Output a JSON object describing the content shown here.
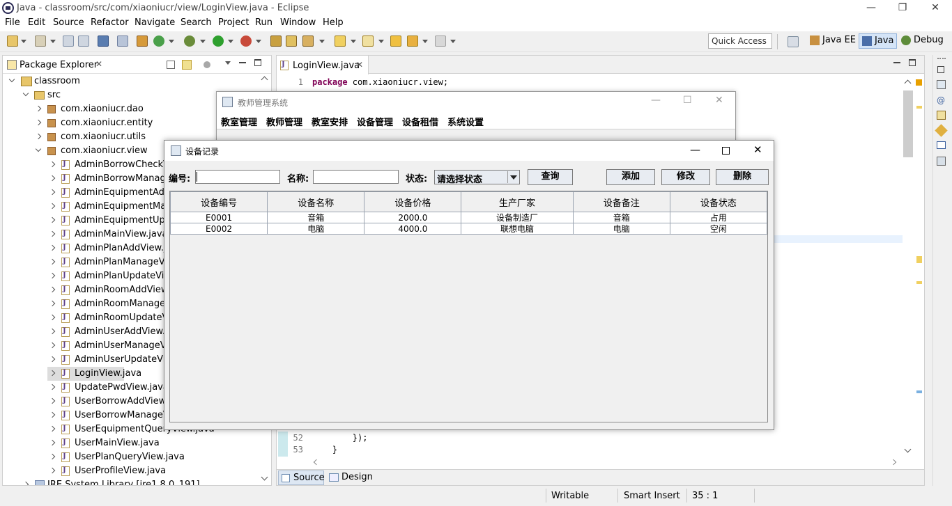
{
  "window": {
    "title": "Java - classroom/src/com/xiaoniucr/view/LoginView.java - Eclipse"
  },
  "menu": [
    "File",
    "Edit",
    "Source",
    "Refactor",
    "Navigate",
    "Search",
    "Project",
    "Run",
    "Window",
    "Help"
  ],
  "quick_access": "Quick Access",
  "perspectives": {
    "java_ee": "Java EE",
    "java": "Java",
    "debug": "Debug"
  },
  "package_explorer": {
    "tab_label": "Package Explorer",
    "project": "classroom",
    "src": "src",
    "packages": [
      "com.xiaoniucr.dao",
      "com.xiaoniucr.entity",
      "com.xiaoniucr.utils",
      "com.xiaoniucr.view"
    ],
    "files": [
      "AdminBorrowCheckView.java",
      "AdminBorrowManageView.java",
      "AdminEquipmentAddView.java",
      "AdminEquipmentManageView.java",
      "AdminEquipmentUpdateView.java",
      "AdminMainView.java",
      "AdminPlanAddView.java",
      "AdminPlanManageView.java",
      "AdminPlanUpdateView.java",
      "AdminRoomAddView.java",
      "AdminRoomManageView.java",
      "AdminRoomUpdateView.java",
      "AdminUserAddView.java",
      "AdminUserManageView.java",
      "AdminUserUpdateView.java",
      "LoginView.java",
      "UpdatePwdView.java",
      "UserBorrowAddView.java",
      "UserBorrowManageView.java",
      "UserEquipmentQueryView.java",
      "UserMainView.java",
      "UserPlanQueryView.java",
      "UserProfileView.java"
    ],
    "jre": "JRE System Library [jre1.8.0_191]"
  },
  "editor": {
    "tab_label": "LoginView.java",
    "line1": {
      "num": "1",
      "keyword": "package",
      "text": " com.xiaoniucr.view;"
    },
    "line52": {
      "num": "52",
      "text": "        });"
    },
    "line53": {
      "num": "53",
      "text": "    }"
    },
    "bottom_tabs": {
      "source": "Source",
      "design": "Design"
    }
  },
  "status_bar": {
    "writable": "Writable",
    "insert_mode": "Smart Insert",
    "position": "35 : 1"
  },
  "main_app": {
    "title": "教师管理系统",
    "menu": [
      "教室管理",
      "教师管理",
      "教室安排",
      "设备管理",
      "设备租借",
      "系统设置"
    ]
  },
  "dialog": {
    "title": "设备记录",
    "id_label": "编号:",
    "id_value": "",
    "name_label": "名称:",
    "name_value": "",
    "status_label": "状态:",
    "status_selected": "请选择状态",
    "buttons": {
      "query": "查询",
      "add": "添加",
      "edit": "修改",
      "delete": "删除"
    },
    "table": {
      "columns": [
        "设备编号",
        "设备名称",
        "设备价格",
        "生产厂家",
        "设备备注",
        "设备状态"
      ],
      "rows": [
        [
          "E0001",
          "音箱",
          "2000.0",
          "设备制造厂",
          "音箱",
          "占用"
        ],
        [
          "E0002",
          "电脑",
          "4000.0",
          "联想电脑",
          "电脑",
          "空闲"
        ]
      ]
    }
  }
}
